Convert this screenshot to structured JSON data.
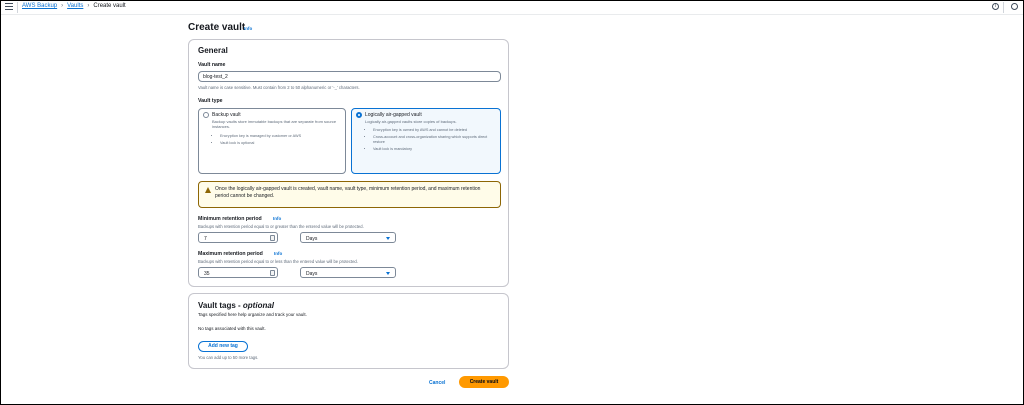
{
  "breadcrumbs": [
    "AWS Backup",
    "Vaults",
    "Create vault"
  ],
  "header_icons": [
    "info-circle-icon",
    "settings-circle-icon"
  ],
  "page": {
    "title": "Create vault",
    "info": "Info"
  },
  "general": {
    "heading": "General",
    "vault_name_label": "Vault name",
    "vault_name_value": "blog-test_2",
    "vault_name_hint": "Vault name is case sensitive. Must contain from 2 to 50 alphanumeric or '-_' characters.",
    "vault_type_label": "Vault type",
    "options": [
      {
        "title": "Backup vault",
        "description": "Backup vaults store immutable backups that are separate from source instances.",
        "bullets": [
          "Encryption key is managed by customer or AWS",
          "Vault lock is optional"
        ],
        "selected": false
      },
      {
        "title": "Logically air-gapped vault",
        "description": "Logically air-gapped vaults store copies of backups.",
        "bullets": [
          "Encryption key is owned by AWS and cannot be deleted",
          "Cross-account and cross-organization sharing which supports direct restore",
          "Vault lock is mandatory"
        ],
        "selected": true
      }
    ],
    "alert": "Once the logically air-gapped vault is created, vault name, vault type, minimum retention period, and maximum retention period cannot be changed.",
    "min_label": "Minimum retention period",
    "min_info": "Info",
    "min_hint": "Backups with retention period equal to or greater than the entered value will be protected.",
    "min_value": "7",
    "min_unit": "Days",
    "max_label": "Maximum retention period",
    "max_info": "Info",
    "max_hint": "Backups with retention period equal to or less than the entered value will be protected.",
    "max_value": "35",
    "max_unit": "Days"
  },
  "tags": {
    "heading_main": "Vault tags - ",
    "heading_optional": "optional",
    "description": "Tags specified here help organize and track your vault.",
    "empty": "No tags associated with this vault.",
    "add_button": "Add new tag",
    "limit": "You can add up to 50 more tags."
  },
  "actions": {
    "cancel": "Cancel",
    "submit": "Create vault"
  },
  "colors": {
    "link": "#0972d3",
    "primary": "#ff9900",
    "alert_bg": "#fffce9"
  }
}
